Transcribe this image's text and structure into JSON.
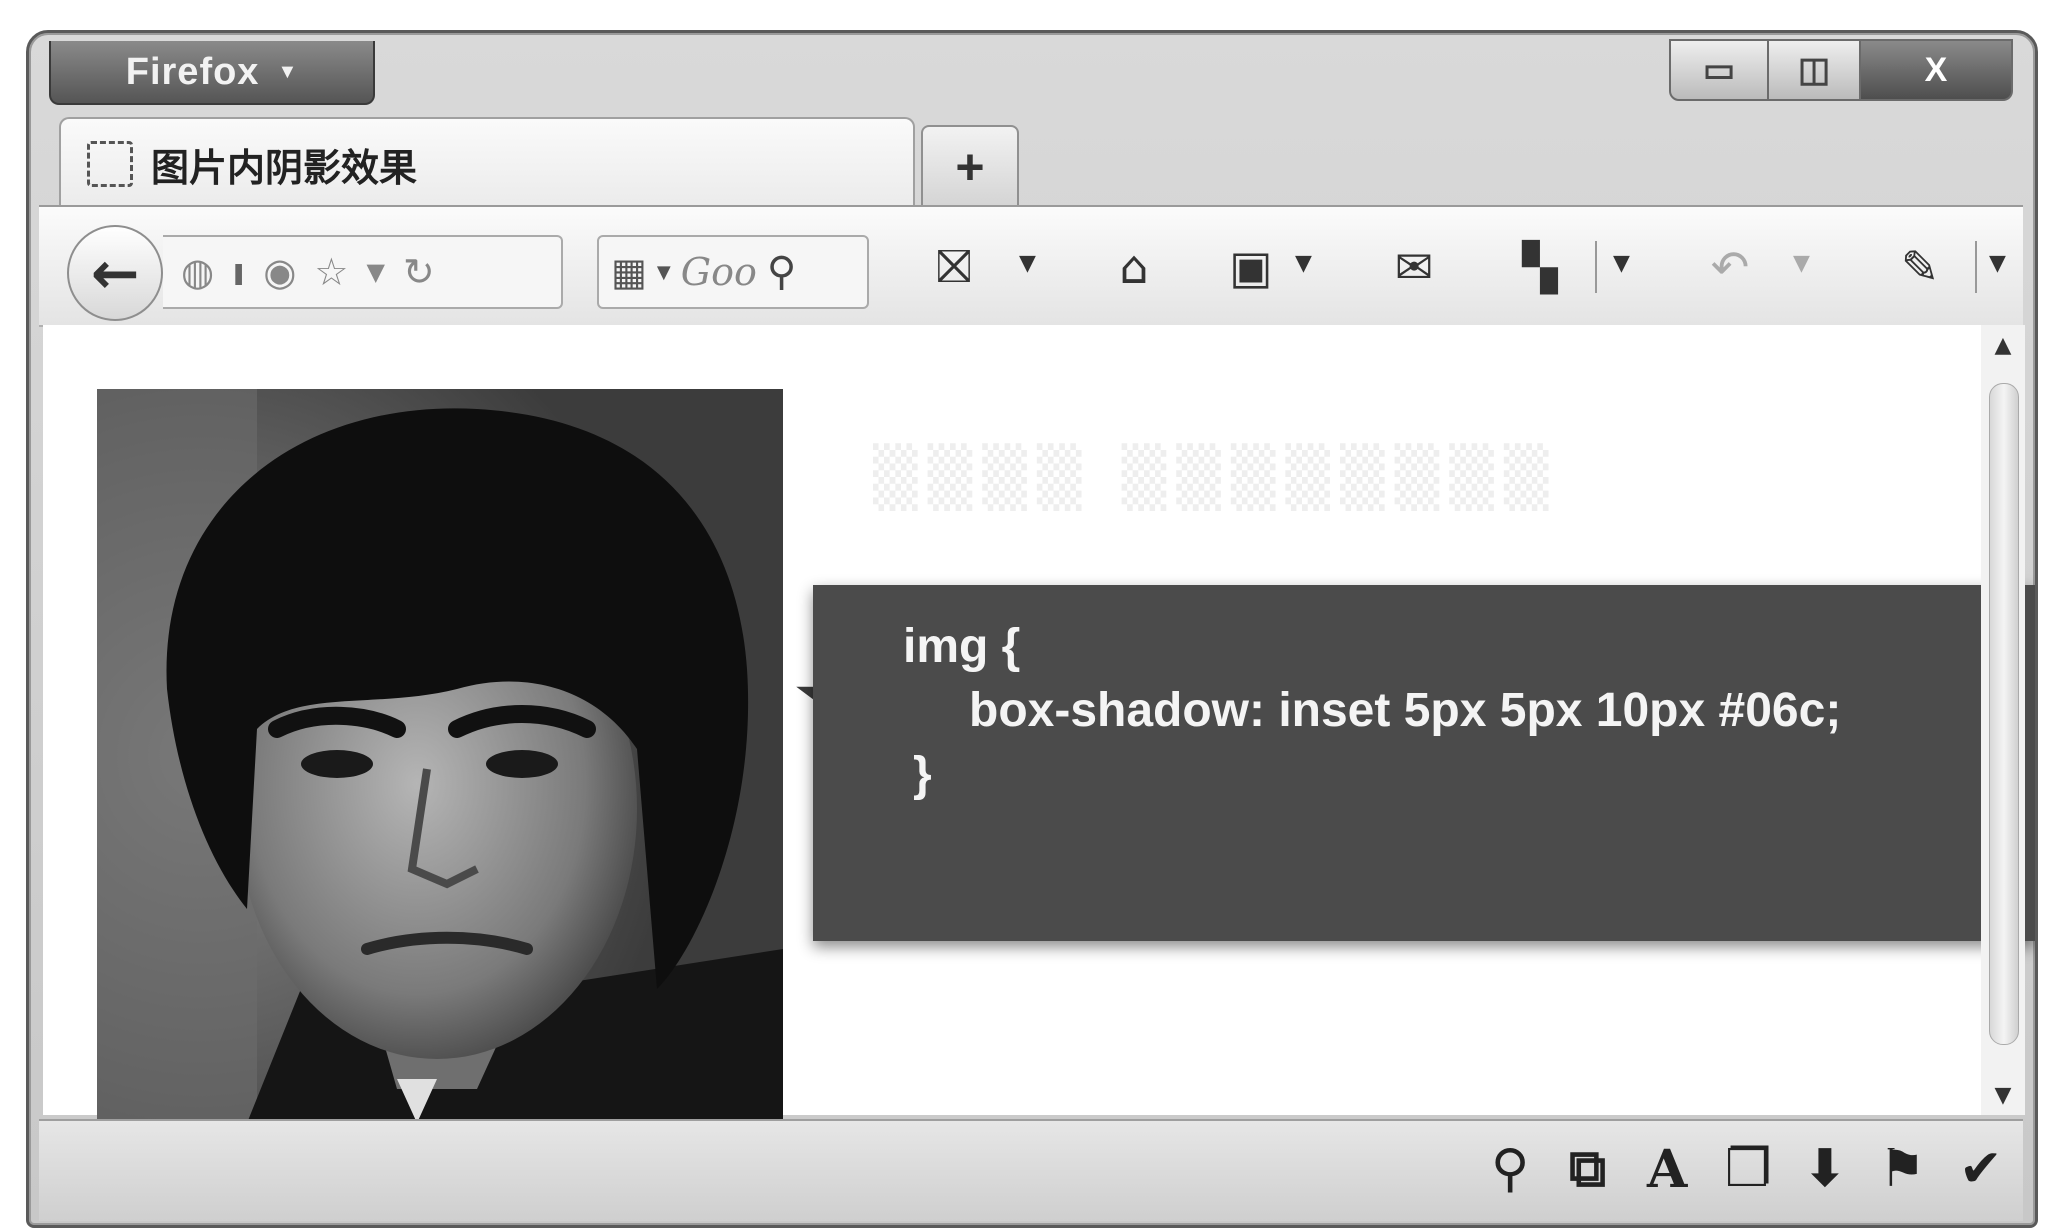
{
  "window": {
    "app_button": "Firefox",
    "controls": {
      "minimize": "▭",
      "maximize": "◫",
      "close": "X"
    }
  },
  "tabs": [
    {
      "title": "图片内阴影效果",
      "favicon": "blank-page-icon"
    }
  ],
  "new_tab_label": "+",
  "toolbar": {
    "back": "←",
    "search_placeholder": "Goo",
    "icons": [
      "back-arrow-icon",
      "globe-icon",
      "info-icon",
      "world-icon",
      "star-icon",
      "dropdown-icon",
      "reload-icon",
      "search-engine-icon",
      "web-developer-icon",
      "home-icon",
      "bookmarks-icon",
      "mail-icon",
      "apps-icon",
      "undo-icon",
      "extension-icon"
    ]
  },
  "content": {
    "image": "portrait photo",
    "code_lines": [
      "img {",
      "box-shadow: inset 5px 5px 10px #06c;",
      "}"
    ]
  },
  "addon_bar": {
    "icons": [
      "magnifier-icon",
      "open-window-icon",
      "font-icon",
      "windows-icon",
      "download-icon",
      "flag-icon",
      "tools-icon"
    ]
  },
  "colors": {
    "code_bg": "#4b4b4b",
    "code_text": "#f4f4f4",
    "chrome": "#d6d6d6"
  }
}
